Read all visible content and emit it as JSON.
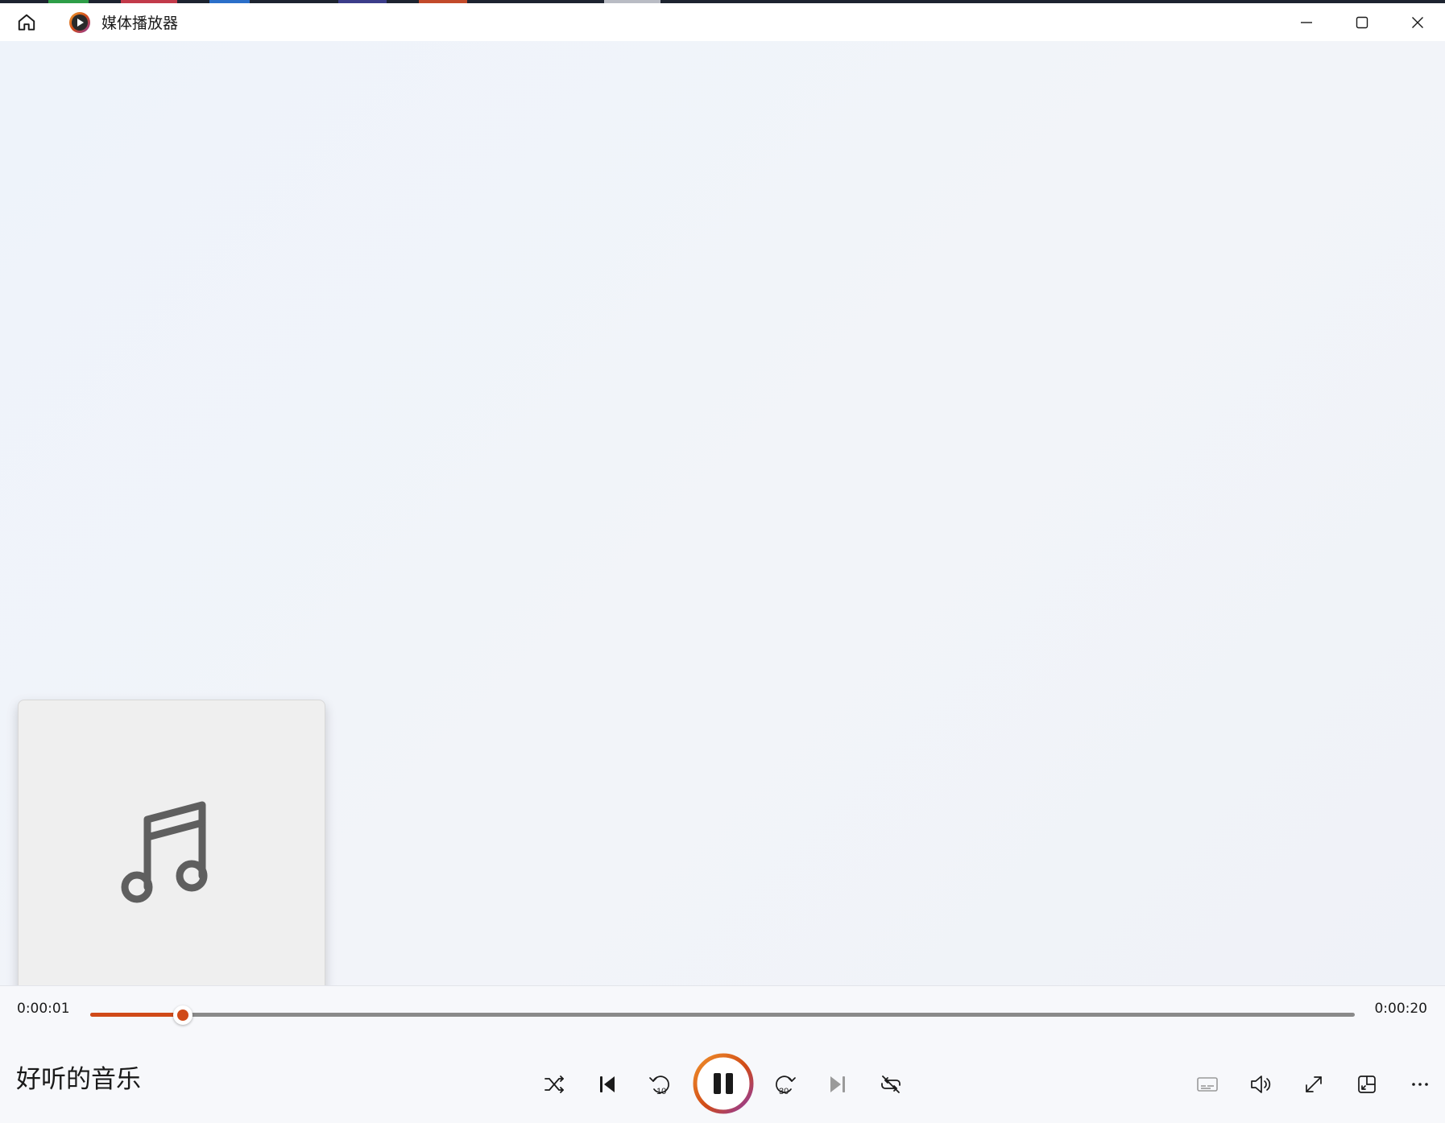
{
  "app": {
    "title": "媒体播放器"
  },
  "player": {
    "current_time": "0:00:01",
    "total_time": "0:00:20",
    "progress_fraction": 0.073,
    "track_title": "好听的音乐"
  },
  "icons": {
    "home": "home-icon",
    "logo": "media-player-logo",
    "minimize": "minimize-icon",
    "maximize": "maximize-icon",
    "close": "close-icon",
    "album_art": "music-note-icon",
    "shuffle": "shuffle-icon",
    "previous": "previous-icon",
    "rewind": "rewind-10-icon",
    "pause": "pause-icon",
    "forward": "forward-30-icon",
    "next": "next-icon",
    "repeat": "repeat-off-icon",
    "captions": "captions-icon",
    "volume": "volume-icon",
    "fullscreen": "fullscreen-icon",
    "miniplayer": "miniplayer-icon",
    "more": "more-icon"
  },
  "colors": {
    "accent": "#d04a18",
    "accent_gradient_end": "#8e3aa6"
  },
  "labels": {
    "rewind_seconds": "10",
    "forward_seconds": "30"
  }
}
